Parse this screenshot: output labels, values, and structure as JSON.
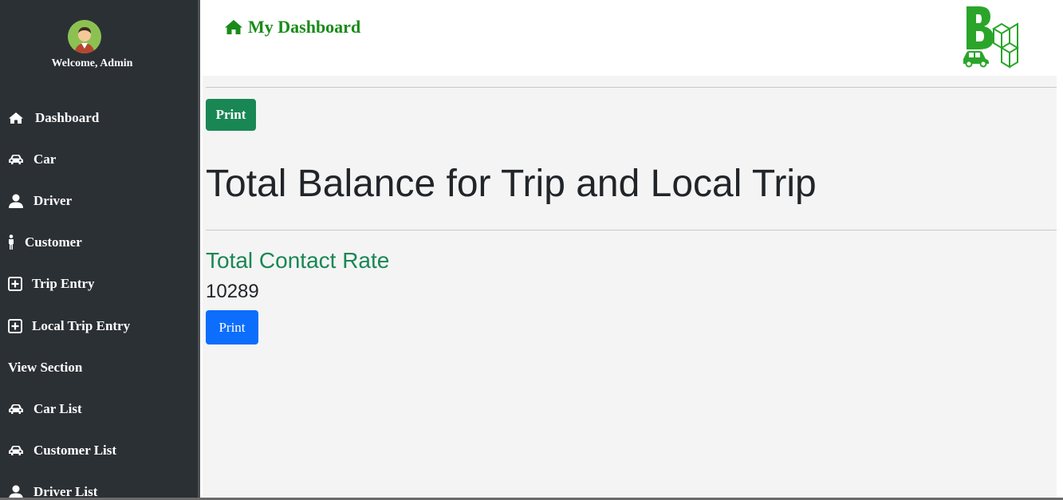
{
  "sidebar": {
    "welcome": "Welcome, Admin",
    "items": [
      {
        "label": "Dashboard",
        "icon": "home-icon"
      },
      {
        "label": "Car",
        "icon": "car-icon"
      },
      {
        "label": "Driver",
        "icon": "user-icon"
      },
      {
        "label": "Customer",
        "icon": "person-icon"
      },
      {
        "label": "Trip Entry",
        "icon": "plus-square-icon"
      },
      {
        "label": "Local Trip Entry",
        "icon": "plus-square-icon"
      },
      {
        "label": "View Section",
        "icon": ""
      },
      {
        "label": "Car List",
        "icon": "car-icon"
      },
      {
        "label": "Customer List",
        "icon": "car-icon"
      },
      {
        "label": "Driver List",
        "icon": "user-icon"
      }
    ]
  },
  "header": {
    "title": "My Dashboard",
    "icon": "home-icon"
  },
  "main": {
    "print_top_label": "Print",
    "title": "Total Balance for Trip and Local Trip",
    "rate_label": "Total Contact Rate",
    "rate_value": "10289",
    "print_bottom_label": "Print"
  },
  "colors": {
    "sidebar_bg": "#2b3035",
    "brand_green": "#198b19",
    "button_green": "#198754",
    "button_blue": "#0d6efd",
    "main_bg": "#f4f4f4"
  }
}
